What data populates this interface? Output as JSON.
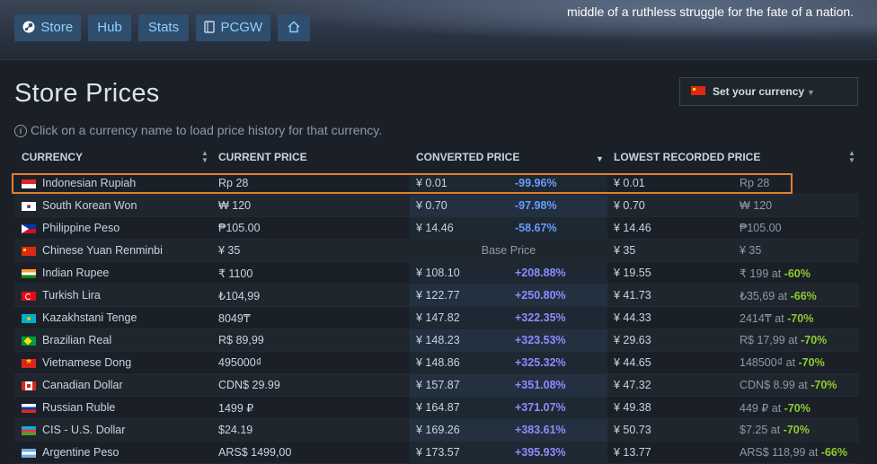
{
  "header": {
    "tagline": "middle of a ruthless struggle for the fate of a nation.",
    "nav": {
      "store": "Store",
      "hub": "Hub",
      "stats": "Stats",
      "pcgw": "PCGW",
      "home_icon": "home-icon"
    }
  },
  "page": {
    "title": "Store Prices",
    "currency_button": "Set your currency",
    "hint": "Click on a currency name to load price history for that currency."
  },
  "table": {
    "columns": {
      "currency": "CURRENCY",
      "current_price": "CURRENT PRICE",
      "converted_price": "CONVERTED PRICE",
      "lowest_recorded": "LOWEST RECORDED PRICE"
    },
    "rows": [
      {
        "flag": "id",
        "name": "Indonesian Rupiah",
        "price": "Rp 28",
        "conv": "¥ 0.01",
        "pct": "-99.96%",
        "low": "¥ 0.01",
        "lowloc": "Rp 28",
        "at": "",
        "disc": ""
      },
      {
        "flag": "kr",
        "name": "South Korean Won",
        "price": "₩ 120",
        "conv": "¥ 0.70",
        "pct": "-97.98%",
        "low": "¥ 0.70",
        "lowloc": "₩ 120",
        "at": "",
        "disc": ""
      },
      {
        "flag": "ph",
        "name": "Philippine Peso",
        "price": "₱105.00",
        "conv": "¥ 14.46",
        "pct": "-58.67%",
        "low": "¥ 14.46",
        "lowloc": "₱105.00",
        "at": "",
        "disc": ""
      },
      {
        "flag": "cn",
        "name": "Chinese Yuan Renminbi",
        "price": "¥ 35",
        "base": "Base Price",
        "low": "¥ 35",
        "lowloc": "¥ 35",
        "at": "",
        "disc": ""
      },
      {
        "flag": "in",
        "name": "Indian Rupee",
        "price": "₹ 1100",
        "conv": "¥ 108.10",
        "pct": "+208.88%",
        "low": "¥ 19.55",
        "lowloc": "₹ 199",
        "at": " at ",
        "disc": "-60%"
      },
      {
        "flag": "tr",
        "name": "Turkish Lira",
        "price": "₺104,99",
        "conv": "¥ 122.77",
        "pct": "+250.80%",
        "low": "¥ 41.73",
        "lowloc": "₺35,69",
        "at": " at ",
        "disc": "-66%"
      },
      {
        "flag": "kz",
        "name": "Kazakhstani Tenge",
        "price": "8049₸",
        "conv": "¥ 147.82",
        "pct": "+322.35%",
        "low": "¥ 44.33",
        "lowloc": "2414₸",
        "at": " at ",
        "disc": "-70%"
      },
      {
        "flag": "br",
        "name": "Brazilian Real",
        "price": "R$ 89,99",
        "conv": "¥ 148.23",
        "pct": "+323.53%",
        "low": "¥ 29.63",
        "lowloc": "R$ 17,99",
        "at": " at ",
        "disc": "-70%"
      },
      {
        "flag": "vn",
        "name": "Vietnamese Dong",
        "price": "495000₫",
        "conv": "¥ 148.86",
        "pct": "+325.32%",
        "low": "¥ 44.65",
        "lowloc": "148500₫",
        "at": " at ",
        "disc": "-70%"
      },
      {
        "flag": "ca",
        "name": "Canadian Dollar",
        "price": "CDN$ 29.99",
        "conv": "¥ 157.87",
        "pct": "+351.08%",
        "low": "¥ 47.32",
        "lowloc": "CDN$ 8.99",
        "at": " at ",
        "disc": "-70%"
      },
      {
        "flag": "ru",
        "name": "Russian Ruble",
        "price": "1499 ₽",
        "conv": "¥ 164.87",
        "pct": "+371.07%",
        "low": "¥ 49.38",
        "lowloc": "449 ₽",
        "at": " at ",
        "disc": "-70%"
      },
      {
        "flag": "cis",
        "name": "CIS - U.S. Dollar",
        "price": "$24.19",
        "conv": "¥ 169.26",
        "pct": "+383.61%",
        "low": "¥ 50.73",
        "lowloc": "$7.25",
        "at": " at ",
        "disc": "-70%"
      },
      {
        "flag": "ar",
        "name": "Argentine Peso",
        "price": "ARS$ 1499,00",
        "conv": "¥ 173.57",
        "pct": "+395.93%",
        "low": "¥ 13.77",
        "lowloc": "ARS$ 118,99",
        "at": " at ",
        "disc": "-66%"
      }
    ]
  }
}
